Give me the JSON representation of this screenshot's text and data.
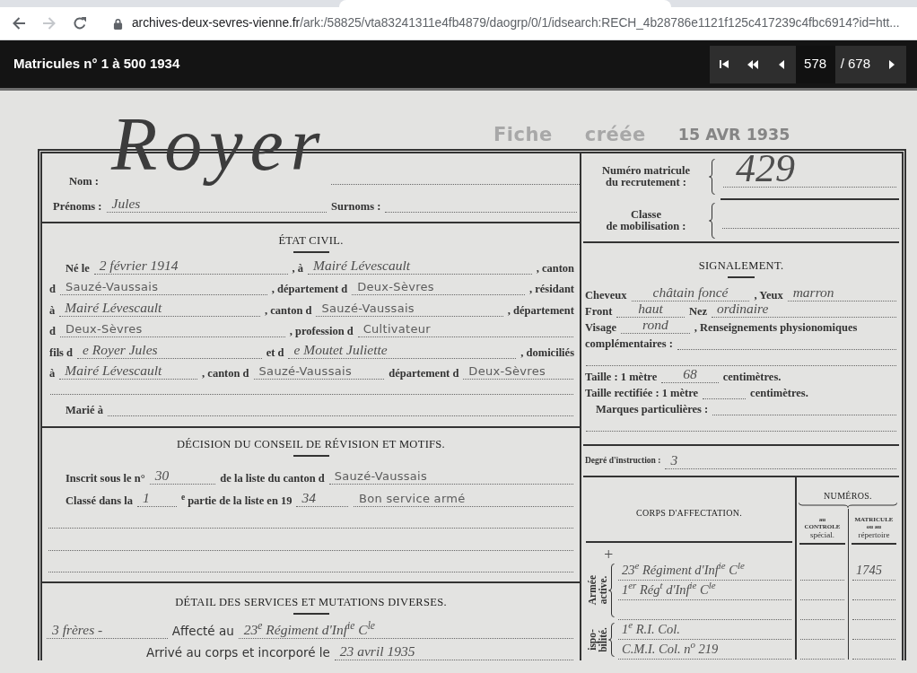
{
  "browser": {
    "buttons": [
      {
        "kind": "back",
        "disabled": false
      },
      {
        "kind": "forward",
        "disabled": true
      },
      {
        "kind": "reload",
        "disabled": false
      }
    ],
    "address": {
      "host": "archives-deux-sevres-vienne.fr",
      "path": "/ark:/58825/vta83241311e4fb4879/daogrp/0/1/idsearch:RECH_4b28786e1121f125c417239c4fbc6914?id=htt..."
    }
  },
  "viewer": {
    "title": "Matricules n° 1 à 500 1934",
    "page": "578",
    "total": "/ 678"
  },
  "document": {
    "stamp": [
      "Fiche",
      "créée",
      "15 AVR 1935"
    ],
    "identity": {
      "lines": [
        [
          {
            "kind": "label",
            "text": "Nom :"
          },
          {
            "kind": "surname",
            "text": "Royer"
          }
        ],
        [
          {
            "kind": "label",
            "text": "Prénoms :"
          },
          {
            "kind": "hand",
            "text": "Jules"
          },
          {
            "kind": "label",
            "text": "Surnoms :"
          },
          {
            "kind": "blank"
          }
        ]
      ]
    },
    "etat_civil": {
      "heading": "ÉTAT CIVIL.",
      "lines": [
        [
          {
            "kind": "label",
            "text": "Né le"
          },
          {
            "kind": "hand",
            "text": "2 février 1914"
          },
          {
            "kind": "label",
            "text": ", à"
          },
          {
            "kind": "hand",
            "text": "Mairé Lévescault"
          },
          {
            "kind": "label",
            "text": ", canton"
          }
        ],
        [
          {
            "kind": "label",
            "text": "d"
          },
          {
            "kind": "typed",
            "text": "Sauzé-Vaussais"
          },
          {
            "kind": "label",
            "text": ", département d"
          },
          {
            "kind": "typed",
            "text": "Deux-Sèvres"
          },
          {
            "kind": "label",
            "text": ", résidant"
          }
        ],
        [
          {
            "kind": "label",
            "text": "à"
          },
          {
            "kind": "hand",
            "text": "Mairé Lévescault"
          },
          {
            "kind": "label",
            "text": ", canton d"
          },
          {
            "kind": "typed",
            "text": "Sauzé-Vaussais"
          },
          {
            "kind": "label",
            "text": ", département"
          }
        ],
        [
          {
            "kind": "label",
            "text": "d"
          },
          {
            "kind": "typed",
            "text": "Deux-Sèvres"
          },
          {
            "kind": "label",
            "text": ", profession d"
          },
          {
            "kind": "typed",
            "text": "Cultivateur"
          }
        ],
        [
          {
            "kind": "label",
            "text": "fils d"
          },
          {
            "kind": "hand",
            "text": "e Royer Jules"
          },
          {
            "kind": "label",
            "text": "et d"
          },
          {
            "kind": "hand",
            "text": "e Moutet Juliette"
          },
          {
            "kind": "label",
            "text": ", domiciliés"
          }
        ],
        [
          {
            "kind": "label",
            "text": "à"
          },
          {
            "kind": "hand",
            "text": "Mairé Lévescault"
          },
          {
            "kind": "label",
            "text": ", canton d"
          },
          {
            "kind": "typed",
            "text": "Sauzé-Vaussais"
          },
          {
            "kind": "label",
            "text": "département d"
          },
          {
            "kind": "typed",
            "text": "Deux-Sèvres"
          }
        ],
        [
          {
            "kind": "blank"
          }
        ],
        [
          {
            "kind": "label",
            "text": "Marié à"
          },
          {
            "kind": "blank"
          }
        ]
      ]
    },
    "decision": {
      "heading": "DÉCISION DU CONSEIL DE RÉVISION ET MOTIFS.",
      "lines": [
        [
          {
            "kind": "label",
            "text": "Inscrit sous le n°"
          },
          {
            "kind": "hand",
            "text": "30"
          },
          {
            "kind": "label",
            "text": "de la liste du canton d"
          },
          {
            "kind": "typed",
            "text": "Sauzé-Vaussais"
          }
        ],
        [
          {
            "kind": "label",
            "text": "Classé dans la"
          },
          {
            "kind": "hand",
            "text": "1"
          },
          {
            "kind": "label",
            "text": "$^{e}$ partie de la liste en 19"
          },
          {
            "kind": "hand",
            "text": "34"
          },
          {
            "kind": "typed",
            "text": "Bon service armé"
          }
        ],
        [
          {
            "kind": "blank"
          }
        ],
        [
          {
            "kind": "blank"
          }
        ],
        [
          {
            "kind": "blank"
          }
        ]
      ]
    },
    "services": {
      "heading": "DÉTAIL DES SERVICES ET MUTATIONS DIVERSES.",
      "lines": [
        [
          {
            "kind": "hand",
            "text": "3 frères -"
          },
          {
            "kind": "stamp",
            "text": "Affecté au"
          },
          {
            "kind": "hand",
            "text": "23$^{e}$ Régiment d'Inf$^{ie}$ C$^{le}$"
          }
        ],
        [
          {
            "kind": "stamp",
            "text": "Arrivé au corps et incorporé le"
          },
          {
            "kind": "hand",
            "text": "23 avril 1935"
          }
        ]
      ]
    },
    "matricule": {
      "label": [
        "Numéro matricule",
        "du recrutement :"
      ],
      "value": "429"
    },
    "classe": {
      "label": [
        "Classe",
        "de mobilisation :"
      ]
    },
    "signalement": {
      "heading": "SIGNALEMENT.",
      "lines": [
        [
          {
            "kind": "label",
            "text": "Cheveux"
          },
          {
            "kind": "hand",
            "text": "châtain foncé"
          },
          {
            "kind": "label",
            "text": ", Yeux"
          },
          {
            "kind": "hand",
            "text": "marron"
          }
        ],
        [
          {
            "kind": "label",
            "text": "Front"
          },
          {
            "kind": "hand",
            "text": "haut"
          },
          {
            "kind": "label",
            "text": "Nez"
          },
          {
            "kind": "hand",
            "text": "ordinaire"
          }
        ],
        [
          {
            "kind": "label",
            "text": "Visage"
          },
          {
            "kind": "hand",
            "text": "rond"
          },
          {
            "kind": "label",
            "text": ", Renseignements physionomiques"
          }
        ],
        [
          {
            "kind": "label",
            "text": "complémentaires :"
          },
          {
            "kind": "blank"
          }
        ],
        [
          {
            "kind": "blank"
          }
        ],
        [
          {
            "kind": "label",
            "text": "Taille : 1 mètre"
          },
          {
            "kind": "hand",
            "text": "68"
          },
          {
            "kind": "label",
            "text": "centimètres."
          }
        ],
        [
          {
            "kind": "label",
            "text": "Taille rectifiée : 1 mètre"
          },
          {
            "kind": "blank"
          },
          {
            "kind": "label",
            "text": "centimètres."
          }
        ],
        [
          {
            "kind": "label",
            "text": "Marques particulières :"
          },
          {
            "kind": "blank"
          }
        ],
        [
          {
            "kind": "blank"
          }
        ]
      ]
    },
    "instruction": [
      {
        "kind": "label",
        "text": "Degré d'instruction :"
      },
      {
        "kind": "hand",
        "text": "3"
      }
    ],
    "affectation": {
      "corps_heading": "CORPS D'AFFECTATION.",
      "numeros_heading": "NUMÉROS.",
      "controle_heading": [
        "au",
        "CONTROLE",
        "spécial."
      ],
      "matricule_heading": [
        "MATRICULE",
        "ou au",
        "répertoire"
      ],
      "groups": [
        {
          "label": [
            "Armée",
            "active."
          ],
          "mark": "+",
          "rows": [
            {
              "kind": "entry",
              "corps": "23$^{e}$ Régiment d'Inf$^{ie}$ C$^{le}$",
              "matricule": "1745"
            },
            {
              "kind": "entry",
              "corps": "1$^{er}$ Rég$^{t}$ d'Inf$^{ie}$ C$^{le}$"
            },
            {
              "kind": "blank"
            }
          ]
        },
        {
          "label": [
            "ispo-",
            "bilité."
          ],
          "rows": [
            {
              "kind": "entry",
              "corps": "1$^{e}$ R.I. Col."
            },
            {
              "kind": "entry",
              "corps": "C.M.I. Col. n$^{o}$ 219"
            }
          ]
        }
      ]
    }
  }
}
